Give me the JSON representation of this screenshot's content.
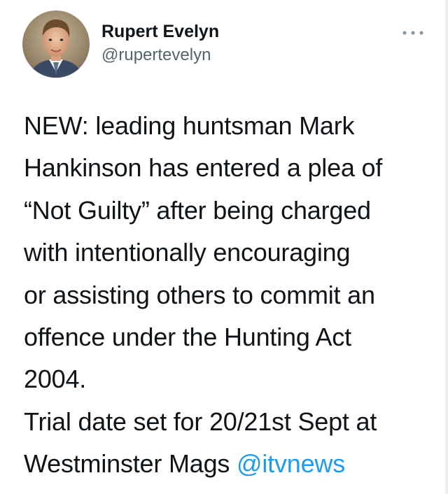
{
  "author": {
    "name": "Rupert Evelyn",
    "handle": "@rupertevelyn",
    "avatar_icon": "profile-photo"
  },
  "more_icon": "ellipsis-icon",
  "tweet": {
    "lines": [
      "NEW: leading huntsman Mark",
      "Hankinson has entered a plea of",
      "“Not Guilty” after being charged",
      "with intentionally encouraging",
      "or assisting others to commit an",
      "offence under the Hunting Act",
      "2004.",
      "Trial date set for 20/21st Sept at"
    ],
    "last_line_prefix": "Westminster Mags ",
    "mention": "@itvnews"
  },
  "colors": {
    "text": "#0f1419",
    "secondary": "#536471",
    "link": "#1d9bf0"
  }
}
